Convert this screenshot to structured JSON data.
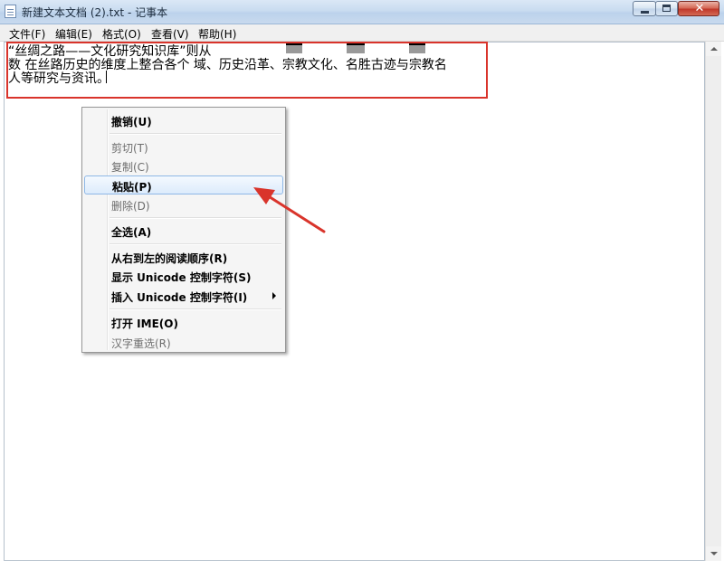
{
  "window": {
    "title": "新建文本文档 (2).txt - 记事本"
  },
  "menubar": {
    "items": [
      "文件(F)",
      "编辑(E)",
      "格式(O)",
      "查看(V)",
      "帮助(H)"
    ]
  },
  "editor": {
    "lines": [
      "“丝绸之路——文化研究知识库”则从",
      "数  在丝路历史的维度上整合各个  域、历史沿革、宗教文化、名胜古迹与宗教名",
      "人等研究与资讯。"
    ]
  },
  "context_menu": {
    "groups": [
      [
        {
          "label": "撤销(U)",
          "enabled": true
        }
      ],
      [
        {
          "label": "剪切(T)",
          "enabled": false
        },
        {
          "label": "复制(C)",
          "enabled": false
        },
        {
          "label": "粘贴(P)",
          "enabled": true,
          "highlighted": true
        },
        {
          "label": "删除(D)",
          "enabled": false
        }
      ],
      [
        {
          "label": "全选(A)",
          "enabled": true
        }
      ],
      [
        {
          "label": "从右到左的阅读顺序(R)",
          "enabled": true
        },
        {
          "label": "显示 Unicode 控制字符(S)",
          "enabled": true
        },
        {
          "label": "插入 Unicode 控制字符(I)",
          "enabled": true,
          "submenu": true
        }
      ],
      [
        {
          "label": "打开 IME(O)",
          "enabled": true
        },
        {
          "label": "汉字重选(R)",
          "enabled": false
        }
      ]
    ]
  },
  "annotation": {
    "color": "#d9342b"
  }
}
